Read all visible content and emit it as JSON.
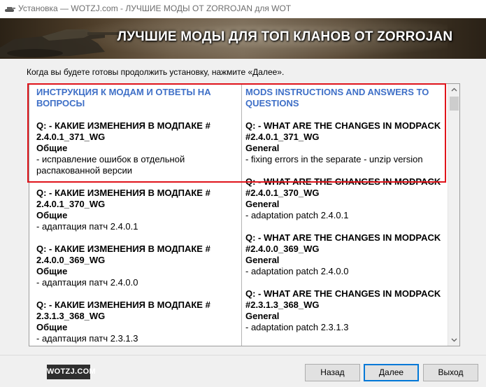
{
  "window": {
    "title": "Установка — WOTZJ.com - ЛУЧШИЕ МОДЫ ОТ ZORROJAN для WOT"
  },
  "banner": {
    "title": "ЛУЧШИЕ МОДЫ ДЛЯ ТОП КЛАНОВ ОТ ZORROJAN"
  },
  "instruction": "Когда вы будете готовы продолжить установку, нажмите «Далее».",
  "left": {
    "heading": "ИНСТРУКЦИЯ К МОДАМ И ОТВЕТЫ НА ВОПРОСЫ",
    "entries": [
      {
        "q": "Q: - КАКИЕ ИЗМЕНЕНИЯ В МОДПАКЕ # 2.4.0.1_371_WG",
        "cat": "Общие",
        "desc": "- исправление ошибок в отдельной распакованной версии"
      },
      {
        "q": "Q: - КАКИЕ ИЗМЕНЕНИЯ В МОДПАКЕ # 2.4.0.1_370_WG",
        "cat": "Общие",
        "desc": "- адаптация патч 2.4.0.1"
      },
      {
        "q": "Q: - КАКИЕ ИЗМЕНЕНИЯ В МОДПАКЕ # 2.4.0.0_369_WG",
        "cat": "Общие",
        "desc": "- адаптация патч 2.4.0.0"
      },
      {
        "q": "Q: - КАКИЕ ИЗМЕНЕНИЯ В МОДПАКЕ # 2.3.1.3_368_WG",
        "cat": "Общие",
        "desc": "- адаптация патч 2.3.1.3"
      }
    ]
  },
  "right": {
    "heading": "MODS INSTRUCTIONS AND ANSWERS TO QUESTIONS",
    "entries": [
      {
        "q": "Q: - WHAT ARE THE CHANGES IN MODPACK #2.4.0.1_371_WG",
        "cat": "General",
        "desc": "- fixing errors in the separate - unzip version"
      },
      {
        "q": "Q: - WHAT ARE THE CHANGES IN MODPACK #2.4.0.1_370_WG",
        "cat": "General",
        "desc": "- adaptation patch 2.4.0.1"
      },
      {
        "q": "Q: - WHAT ARE THE CHANGES IN MODPACK #2.4.0.0_369_WG",
        "cat": "General",
        "desc": "- adaptation patch 2.4.0.0"
      },
      {
        "q": "Q: - WHAT ARE THE CHANGES IN MODPACK #2.3.1.3_368_WG",
        "cat": "General",
        "desc": "- adaptation patch 2.3.1.3"
      }
    ]
  },
  "footer": {
    "brand": "WOTZJ.COM",
    "back_label": "Назад",
    "next_label": "Далее",
    "exit_label": "Выход"
  },
  "colors": {
    "heading": "#3e6fc7",
    "highlight": "#e0141b",
    "accent": "#0078d7"
  },
  "icons": {
    "app": "tank-icon",
    "scroll_up": "chevron-up-icon",
    "scroll_down": "chevron-down-icon"
  }
}
